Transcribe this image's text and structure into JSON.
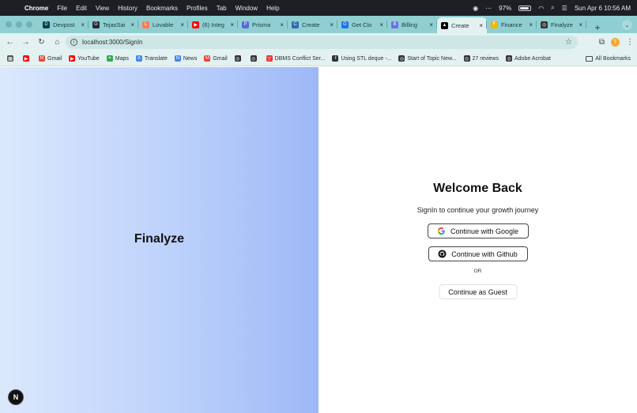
{
  "menubar": {
    "app": "Chrome",
    "items": [
      "File",
      "Edit",
      "View",
      "History",
      "Bookmarks",
      "Profiles",
      "Tab",
      "Window",
      "Help"
    ],
    "battery": "97%",
    "datetime": "Sun Apr 6  10:56 AM"
  },
  "tabs": [
    {
      "label": "Devpost",
      "color": "#003e54",
      "glyph": "D"
    },
    {
      "label": "TejasSai",
      "color": "#24292f",
      "glyph": "G"
    },
    {
      "label": "Lovable",
      "color": "#ff7a59",
      "glyph": "L"
    },
    {
      "label": "(6) Integ",
      "color": "#ff0000",
      "glyph": "▶"
    },
    {
      "label": "Prisma",
      "color": "#5a67d8",
      "glyph": "P"
    },
    {
      "label": "Create",
      "color": "#2b6cb0",
      "glyph": "C"
    },
    {
      "label": "Get Clo",
      "color": "#1a73e8",
      "glyph": "G"
    },
    {
      "label": "Billing",
      "color": "#6772e5",
      "glyph": "B"
    },
    {
      "label": "Create",
      "color": "#000000",
      "glyph": "▲",
      "active": true
    },
    {
      "label": "Finance",
      "color": "#f4b400",
      "glyph": "F"
    },
    {
      "label": "Finalyze",
      "color": "#333333",
      "glyph": "◎"
    }
  ],
  "toolbar": {
    "url": "localhost:3000/SignIn",
    "profile_initial": "T"
  },
  "bookmarks": [
    {
      "label": "",
      "color": "#555555",
      "glyph": "▦"
    },
    {
      "label": "",
      "color": "#ff0000",
      "glyph": "▶"
    },
    {
      "label": "Gmail",
      "color": "#ea4335",
      "glyph": "M"
    },
    {
      "label": "YouTube",
      "color": "#ff0000",
      "glyph": "▶"
    },
    {
      "label": "Maps",
      "color": "#34a853",
      "glyph": "⌖"
    },
    {
      "label": "Translate",
      "color": "#4285f4",
      "glyph": "A"
    },
    {
      "label": "News",
      "color": "#4285f4",
      "glyph": "N"
    },
    {
      "label": "Gmail",
      "color": "#ea4335",
      "glyph": "M"
    },
    {
      "label": "",
      "color": "#333333",
      "glyph": "◎"
    },
    {
      "label": "",
      "color": "#333333",
      "glyph": "◎"
    },
    {
      "label": "DBMS Conflict Ser...",
      "color": "#e53935",
      "glyph": "▽"
    },
    {
      "label": "Using STL deque -...",
      "color": "#333333",
      "glyph": "ℓ"
    },
    {
      "label": "Start of Topic New...",
      "color": "#333333",
      "glyph": "◎"
    },
    {
      "label": "27 reviews",
      "color": "#333333",
      "glyph": "◎"
    },
    {
      "label": "Adobe Acrobat",
      "color": "#333333",
      "glyph": "◎"
    }
  ],
  "bookmarks_all": "All Bookmarks",
  "brand": "Finalyze",
  "signin": {
    "title": "Welcome Back",
    "subtitle": "SignIn to continue your growth journey",
    "google_label": "Continue with Google",
    "github_label": "Continue with Github",
    "or_label": "OR",
    "guest_label": "Continue as Guest"
  },
  "next_badge": "N"
}
